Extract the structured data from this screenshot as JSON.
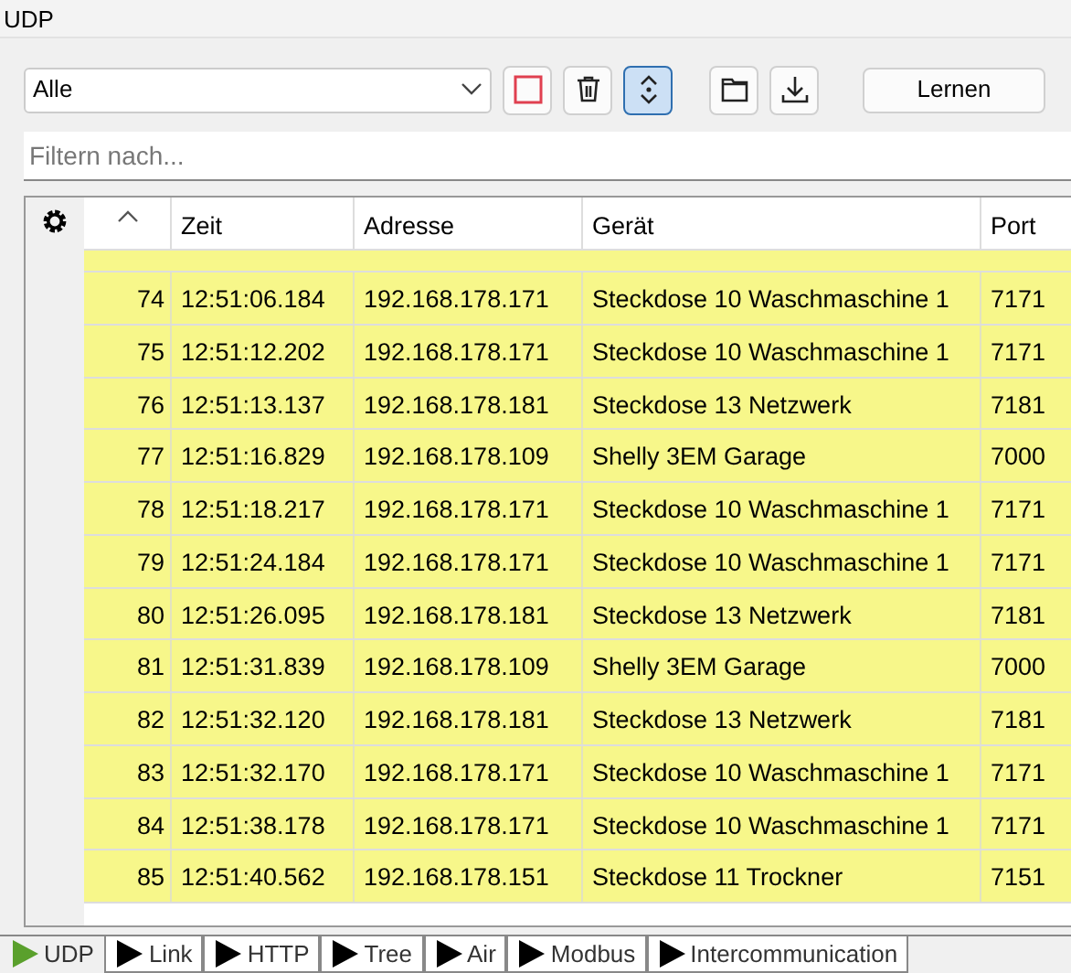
{
  "window": {
    "title": "UDP"
  },
  "toolbar": {
    "filter_select": "Alle",
    "stop_on": false,
    "autoscroll_on": true,
    "learn_button": "Lernen"
  },
  "filter": {
    "placeholder": "Filtern nach..."
  },
  "table": {
    "columns": [
      "Zeit",
      "Adresse",
      "Gerät",
      "Port"
    ],
    "rows": [
      {
        "nr": "74",
        "zeit": "12:51:06.184",
        "adresse": "192.168.178.171",
        "geraet": "Steckdose 10 Waschmaschine 1",
        "port": "7171"
      },
      {
        "nr": "75",
        "zeit": "12:51:12.202",
        "adresse": "192.168.178.171",
        "geraet": "Steckdose 10 Waschmaschine 1",
        "port": "7171"
      },
      {
        "nr": "76",
        "zeit": "12:51:13.137",
        "adresse": "192.168.178.181",
        "geraet": "Steckdose 13 Netzwerk",
        "port": "7181"
      },
      {
        "nr": "77",
        "zeit": "12:51:16.829",
        "adresse": "192.168.178.109",
        "geraet": "Shelly 3EM Garage",
        "port": "7000"
      },
      {
        "nr": "78",
        "zeit": "12:51:18.217",
        "adresse": "192.168.178.171",
        "geraet": "Steckdose 10 Waschmaschine 1",
        "port": "7171"
      },
      {
        "nr": "79",
        "zeit": "12:51:24.184",
        "adresse": "192.168.178.171",
        "geraet": "Steckdose 10 Waschmaschine 1",
        "port": "7171"
      },
      {
        "nr": "80",
        "zeit": "12:51:26.095",
        "adresse": "192.168.178.181",
        "geraet": "Steckdose 13 Netzwerk",
        "port": "7181"
      },
      {
        "nr": "81",
        "zeit": "12:51:31.839",
        "adresse": "192.168.178.109",
        "geraet": "Shelly 3EM Garage",
        "port": "7000"
      },
      {
        "nr": "82",
        "zeit": "12:51:32.120",
        "adresse": "192.168.178.181",
        "geraet": "Steckdose 13 Netzwerk",
        "port": "7181"
      },
      {
        "nr": "83",
        "zeit": "12:51:32.170",
        "adresse": "192.168.178.171",
        "geraet": "Steckdose 10 Waschmaschine 1",
        "port": "7171"
      },
      {
        "nr": "84",
        "zeit": "12:51:38.178",
        "adresse": "192.168.178.171",
        "geraet": "Steckdose 10 Waschmaschine 1",
        "port": "7171"
      },
      {
        "nr": "85",
        "zeit": "12:51:40.562",
        "adresse": "192.168.178.151",
        "geraet": "Steckdose 11 Trockner",
        "port": "7151"
      }
    ]
  },
  "tabs": [
    {
      "label": "UDP",
      "selected": true
    },
    {
      "label": "Link",
      "selected": false
    },
    {
      "label": "HTTP",
      "selected": false
    },
    {
      "label": "Tree",
      "selected": false
    },
    {
      "label": "Air",
      "selected": false
    },
    {
      "label": "Modbus",
      "selected": false
    },
    {
      "label": "Intercommunication",
      "selected": false
    }
  ]
}
